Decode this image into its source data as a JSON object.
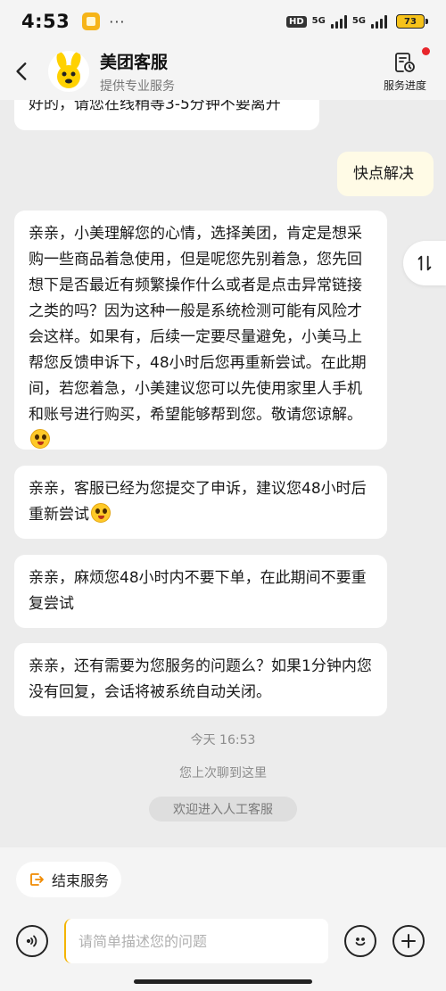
{
  "status_bar": {
    "time": "4:53",
    "dots": "···",
    "hd": "HD",
    "net1": "5G",
    "net2": "5G",
    "battery": "73"
  },
  "header": {
    "title": "美团客服",
    "subtitle": "提供专业服务",
    "progress_label": "服务进度"
  },
  "messages": [
    {
      "from": "agent",
      "text": "好的，请您在线稍等3-5分钟不要离开"
    },
    {
      "from": "user",
      "text": "快点解决"
    },
    {
      "from": "agent",
      "text": "亲亲，小美理解您的心情，选择美团，肯定是想采购一些商品着急使用，但是呢您先别着急，您先回想下是否最近有频繁操作什么或者是点击异常链接之类的吗？因为这种一般是系统检测可能有风险才会这样。如果有，后续一定要尽量避免，小美马上帮您反馈申诉下，48小时后您再重新尝试。在此期间，若您着急，小美建议您可以先使用家里人手机和账号进行购买，希望能够帮到您。敬请您谅解。"
    },
    {
      "from": "agent",
      "text": "亲亲，客服已经为您提交了申诉，建议您48小时后重新尝试"
    },
    {
      "from": "agent",
      "text": "亲亲，麻烦您48小时内不要下单，在此期间不要重复尝试"
    },
    {
      "from": "agent",
      "text": "亲亲，还有需要为您服务的问题么？如果1分钟内您没有回复，会话将被系统自动关闭。"
    }
  ],
  "system": {
    "time": "今天 16:53",
    "last_chat": "您上次聊到这里",
    "welcome": "欢迎进入人工客服"
  },
  "bottom": {
    "end_service_label": "结束服务",
    "input_placeholder": "请简单描述您的问题"
  },
  "colors": {
    "brand_yellow": "#FFD100",
    "user_bubble": "#FFFBE6",
    "background": "#ECECEC",
    "notify_red": "#E8262B"
  }
}
